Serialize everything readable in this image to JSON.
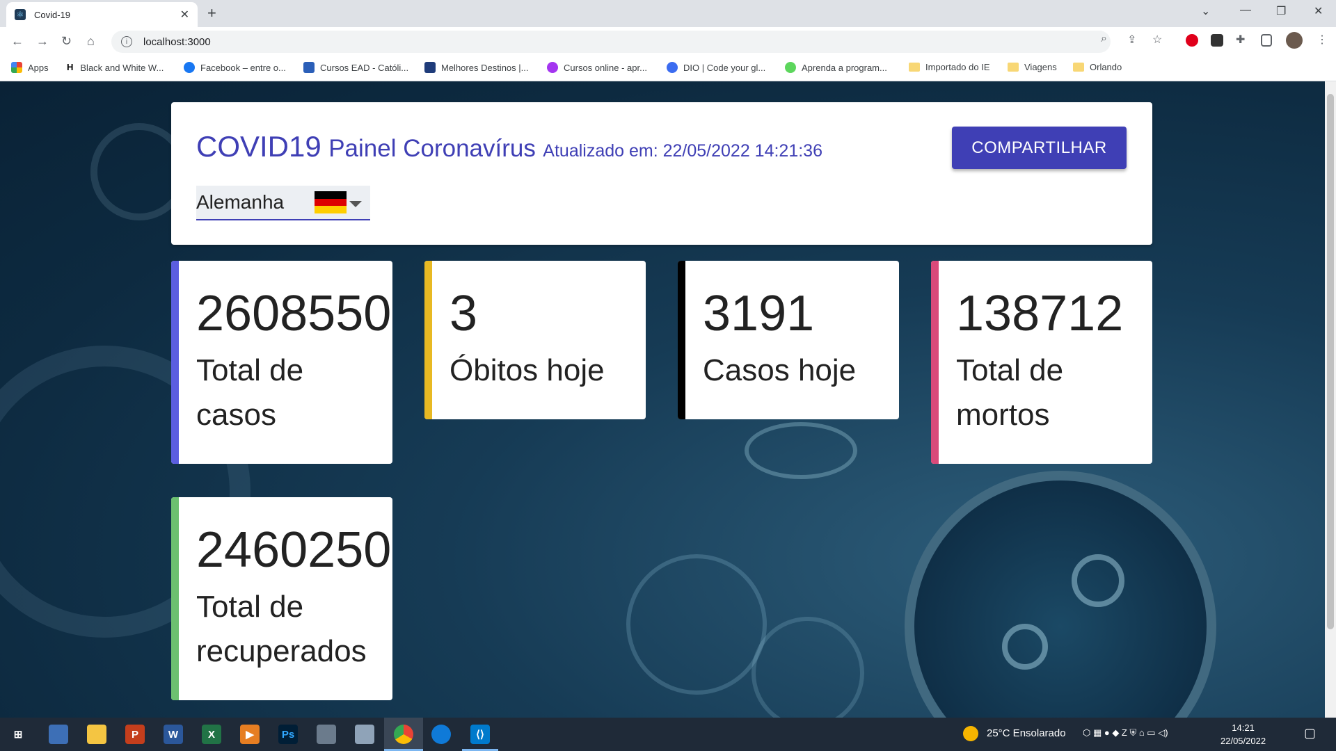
{
  "browser": {
    "tab_title": "Covid-19",
    "url": "localhost:3000",
    "bookmarks": [
      {
        "label": "Apps",
        "icon": "apps-grid-icon"
      },
      {
        "label": "Black and White W...",
        "icon": "h-logo-icon"
      },
      {
        "label": "Facebook – entre o...",
        "icon": "facebook-icon"
      },
      {
        "label": "Cursos EAD - Católi...",
        "icon": "catolica-icon"
      },
      {
        "label": "Melhores Destinos |...",
        "icon": "destinos-icon"
      },
      {
        "label": "Cursos online - apr...",
        "icon": "udemy-icon"
      },
      {
        "label": "DIO | Code your gl...",
        "icon": "dio-icon"
      },
      {
        "label": "Aprenda a program...",
        "icon": "alura-icon"
      },
      {
        "label": "Importado do IE",
        "icon": "folder-icon"
      },
      {
        "label": "Viagens",
        "icon": "folder-icon"
      },
      {
        "label": "Orlando",
        "icon": "folder-icon"
      }
    ]
  },
  "header": {
    "title_main": "COVID19",
    "title_sub": "Painel Coronavírus",
    "updated": "Atualizado em: 22/05/2022 14:21:36",
    "share_label": "COMPARTILHAR",
    "country": "Alemanha"
  },
  "stats": [
    {
      "value": "2608550",
      "label": "Total de casos",
      "color": "#5b5ee0"
    },
    {
      "value": "3",
      "label": "Óbitos hoje",
      "color": "#e8b923"
    },
    {
      "value": "3191",
      "label": "Casos hoje",
      "color": "#000000"
    },
    {
      "value": "138712",
      "label": "Total de mortos",
      "color": "#d94a7a"
    },
    {
      "value": "2460250",
      "label": "Total de recuperados",
      "color": "#6cc070"
    }
  ],
  "taskbar": {
    "weather": "25°C  Ensolarado",
    "time": "14:21",
    "date": "22/05/2022"
  },
  "colors": {
    "accent": "#3f3fb5",
    "page_bg": "#0d2a40"
  }
}
